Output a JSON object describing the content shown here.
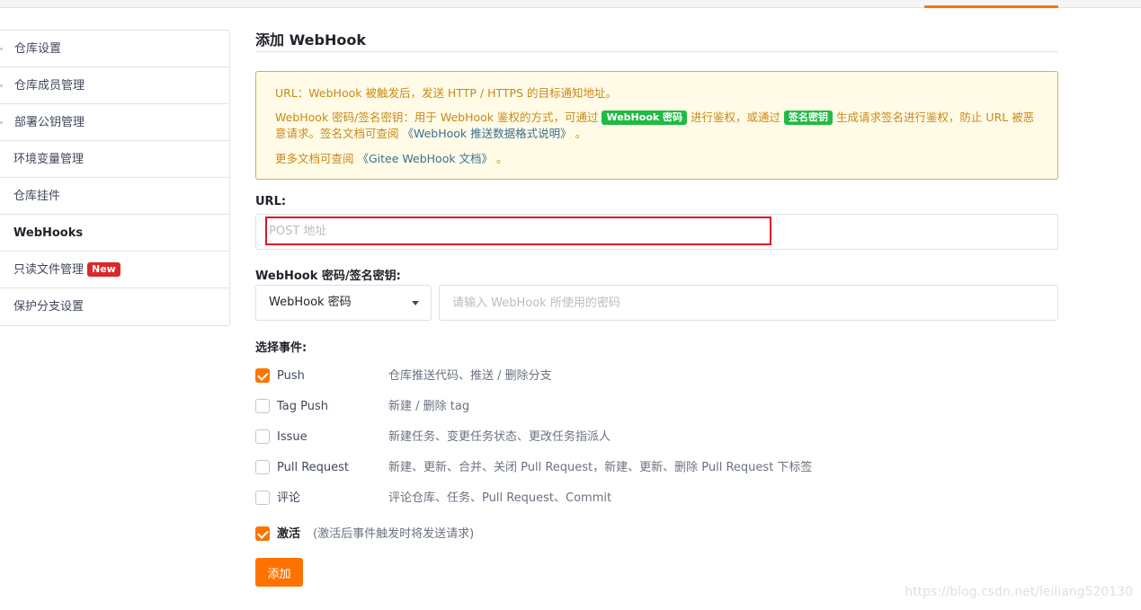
{
  "sidebar": {
    "items": [
      {
        "label": "仓库设置"
      },
      {
        "label": "仓库成员管理"
      },
      {
        "label": "部署公钥管理"
      },
      {
        "label": "环境变量管理"
      },
      {
        "label": "仓库挂件"
      },
      {
        "label": "WebHooks"
      },
      {
        "label": "只读文件管理",
        "badge": "New"
      },
      {
        "label": "保护分支设置"
      }
    ]
  },
  "header": {
    "title": "添加 WebHook"
  },
  "notice": {
    "line1": "URL：WebHook 被触发后，发送 HTTP / HTTPS 的目标通知地址。",
    "line2_pre": "WebHook 密码/签名密钥：用于 WebHook 鉴权的方式，可通过 ",
    "chip1": "WebHook 密码",
    "line2_mid": " 进行鉴权，或通过 ",
    "chip2": "签名密钥",
    "line2_post": " 生成请求签名进行鉴权，防止 URL 被恶意请求。签名文档可查阅 ",
    "link1": "《WebHook 推送数据格式说明》",
    "line2_end": " 。",
    "line3_pre": "更多文档可查阅 ",
    "link2": "《Gitee WebHook 文档》",
    "line3_end": " 。"
  },
  "form": {
    "url_label": "URL:",
    "url_placeholder": "POST 地址",
    "secret_label": "WebHook 密码/签名密钥:",
    "secret_type": "WebHook 密码",
    "secret_placeholder": "请输入 WebHook 所使用的密码",
    "events_label": "选择事件:",
    "events": [
      {
        "name": "Push",
        "desc": "仓库推送代码、推送 / 删除分支",
        "checked": true
      },
      {
        "name": "Tag Push",
        "desc": "新建 / 删除 tag",
        "checked": false
      },
      {
        "name": "Issue",
        "desc": "新建任务、变更任务状态、更改任务指派人",
        "checked": false
      },
      {
        "name": "Pull Request",
        "desc": "新建、更新、合并、关闭 Pull Request，新建、更新、删除 Pull Request 下标签",
        "checked": false
      },
      {
        "name": "评论",
        "desc": "评论仓库、任务、Pull Request、Commit",
        "checked": false
      }
    ],
    "activate_label": "激活",
    "activate_hint": "(激活后事件触发时将发送请求)",
    "activate_checked": true,
    "submit_label": "添加"
  },
  "watermark": "https://blog.csdn.net/leiliang520130",
  "colors": {
    "accent": "#fe7300",
    "chip": "#21ba45",
    "badge": "#db2828",
    "highlight_border": "#e0102f"
  }
}
